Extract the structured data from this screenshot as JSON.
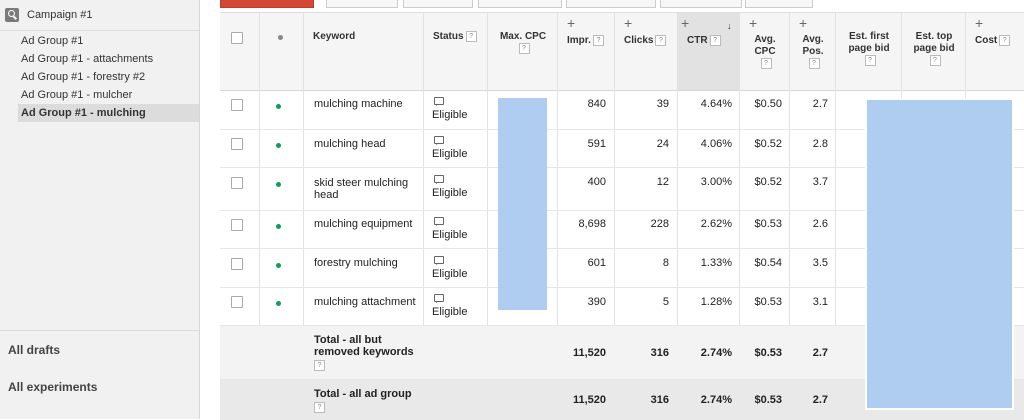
{
  "sidebar": {
    "campaign": "Campaign #1",
    "ad_groups": [
      {
        "label": "Ad Group #1",
        "active": false
      },
      {
        "label": "Ad Group #1 - attachments",
        "active": false
      },
      {
        "label": "Ad Group #1 - forestry #2",
        "active": false
      },
      {
        "label": "Ad Group #1 - mulcher",
        "active": false
      },
      {
        "label": "Ad Group #1 - mulching",
        "active": true
      }
    ],
    "all_drafts": "All drafts",
    "all_experiments": "All experiments"
  },
  "table": {
    "headers": {
      "keyword": "Keyword",
      "status": "Status",
      "max_cpc": "Max. CPC",
      "impr": "Impr.",
      "clicks": "Clicks",
      "ctr": "CTR",
      "avg_cpc_1": "Avg.",
      "avg_cpc_2": "CPC",
      "avg_pos_1": "Avg.",
      "avg_pos_2": "Pos.",
      "est_first_1": "Est. first",
      "est_first_2": "page bid",
      "est_top_1": "Est. top",
      "est_top_2": "page bid",
      "cost": "Cost",
      "help": "?",
      "plus": "+",
      "sort_arrow": "↓"
    },
    "rows": [
      {
        "keyword": "mulching machine",
        "status": "Eligible",
        "impr": "840",
        "clicks": "39",
        "ctr": "4.64%",
        "avg_cpc": "$0.50",
        "avg_pos": "2.7"
      },
      {
        "keyword": "mulching head",
        "status": "Eligible",
        "impr": "591",
        "clicks": "24",
        "ctr": "4.06%",
        "avg_cpc": "$0.52",
        "avg_pos": "2.8"
      },
      {
        "keyword_1": "skid steer mulching",
        "keyword_2": "head",
        "status": "Eligible",
        "impr": "400",
        "clicks": "12",
        "ctr": "3.00%",
        "avg_cpc": "$0.52",
        "avg_pos": "3.7"
      },
      {
        "keyword": "mulching equipment",
        "status": "Eligible",
        "impr": "8,698",
        "clicks": "228",
        "ctr": "2.62%",
        "avg_cpc": "$0.53",
        "avg_pos": "2.6"
      },
      {
        "keyword": "forestry mulching",
        "status": "Eligible",
        "impr": "601",
        "clicks": "8",
        "ctr": "1.33%",
        "avg_cpc": "$0.54",
        "avg_pos": "3.5"
      },
      {
        "keyword": "mulching attachment",
        "status": "Eligible",
        "impr": "390",
        "clicks": "5",
        "ctr": "1.28%",
        "avg_cpc": "$0.53",
        "avg_pos": "3.1"
      }
    ],
    "totals": [
      {
        "label_1": "Total - all but",
        "label_2": "removed keywords",
        "impr": "11,520",
        "clicks": "316",
        "ctr": "2.74%",
        "avg_cpc": "$0.53",
        "avg_pos": "2.7"
      },
      {
        "label_1": "Total - all ad group",
        "impr": "11,520",
        "clicks": "316",
        "ctr": "2.74%",
        "avg_cpc": "$0.53",
        "avg_pos": "2.7"
      }
    ]
  },
  "colors": {
    "accent_button": "#d14836",
    "eligible_dot": "#0f9d58",
    "redaction": "#aecdf1"
  }
}
